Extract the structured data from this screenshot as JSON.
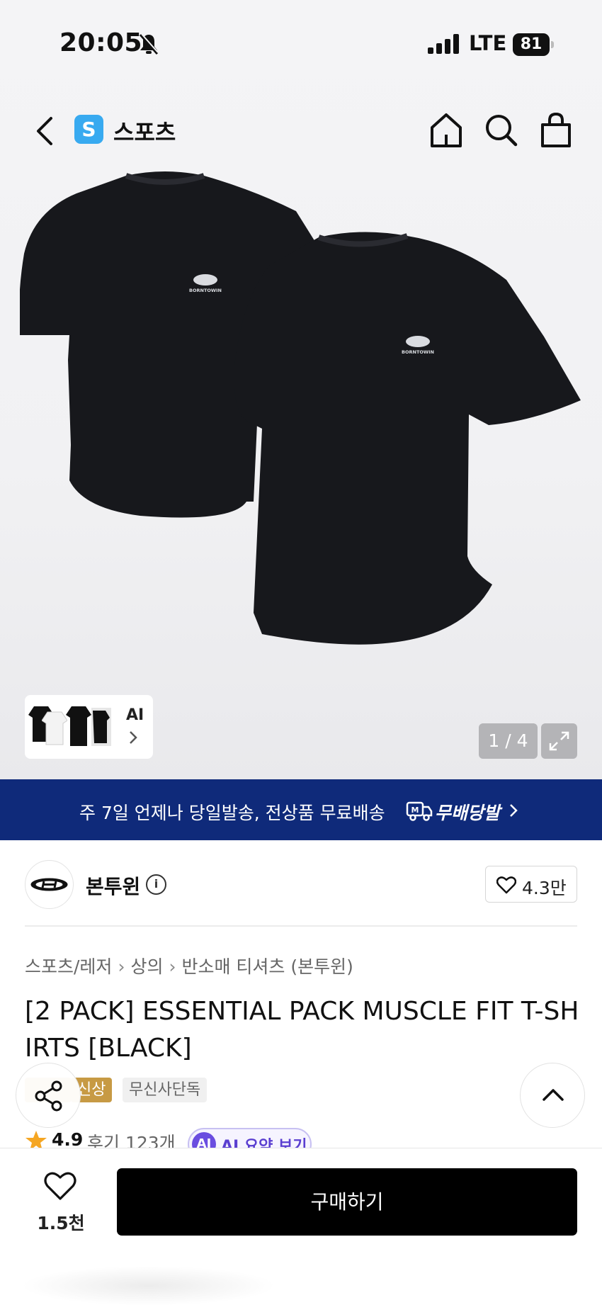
{
  "status_bar": {
    "time": "20:05",
    "network": "LTE",
    "battery": "81"
  },
  "nav": {
    "category_logo": "S",
    "category_title": "스포츠",
    "category_color": "#38aaf0"
  },
  "gallery": {
    "thumbnail_label": "AI",
    "page_current": 1,
    "page_total": 4,
    "page_counter": "1 / 4",
    "shirt_logo_text": "BORNTOWIN"
  },
  "banner": {
    "text": "주 7일 언제나 당일발송, 전상품 무료배송",
    "logo_text": "무배당발",
    "background": "#0f2a7a"
  },
  "brand": {
    "name": "본투윈",
    "likes": "4.3만"
  },
  "breadcrumb": [
    "스포츠/레저",
    "상의",
    "반소매 티셔츠 (본투윈)"
  ],
  "product": {
    "title": "[2 PACK] ESSENTIAL PACK MUSCLE FIT T-SHIRTS [BLACK]",
    "tags": {
      "new": "신상",
      "exclusive": "무신사단독"
    },
    "rating": "4.9",
    "reviews": "후기 123개",
    "ai_summary": "AI 요약 보기",
    "ai_badge": "AI"
  },
  "bottom_bar": {
    "wish_count": "1.5천",
    "buy_label": "구매하기"
  },
  "icons": {
    "back": "chevron-left-icon",
    "home": "home-icon",
    "search": "search-icon",
    "cart": "shopping-bag-icon",
    "share": "share-icon",
    "scroll_top": "chevron-up-icon",
    "wish": "heart-icon"
  }
}
